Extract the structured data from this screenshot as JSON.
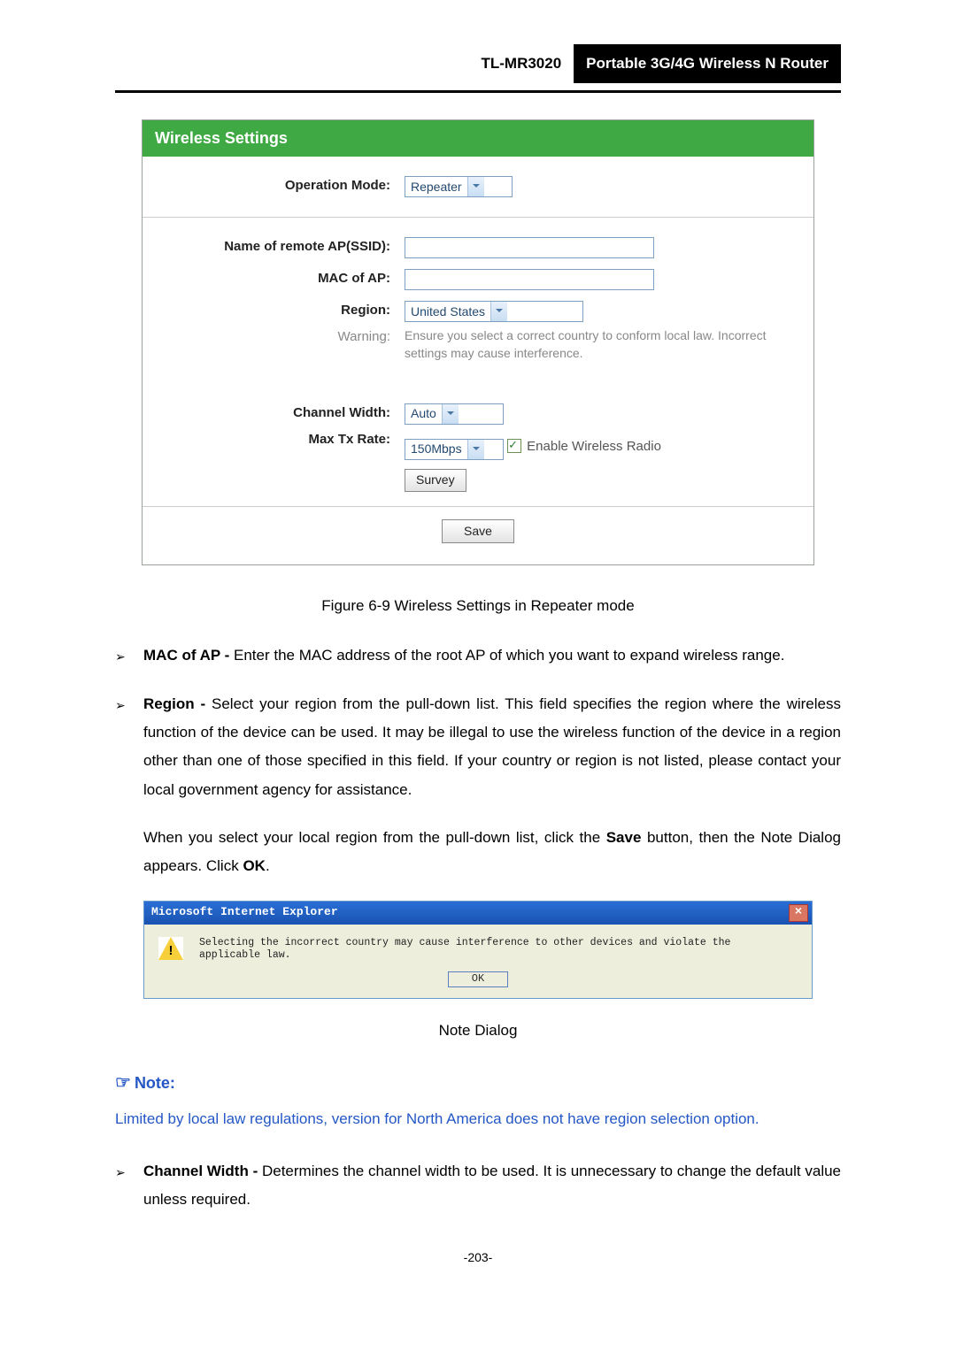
{
  "header": {
    "model": "TL-MR3020",
    "product": "Portable 3G/4G Wireless N Router"
  },
  "panel": {
    "title": "Wireless Settings",
    "labels": {
      "operation_mode": "Operation Mode:",
      "ssid": "Name of remote AP(SSID):",
      "mac": "MAC of AP:",
      "region": "Region:",
      "warning": "Warning:",
      "channel_width": "Channel Width:",
      "max_tx_rate": "Max Tx Rate:"
    },
    "values": {
      "operation_mode": "Repeater",
      "region": "United States",
      "channel_width": "Auto",
      "max_tx_rate": "150Mbps"
    },
    "warning_text": "Ensure you select a correct country to conform local law. Incorrect settings may cause interference.",
    "enable_radio": "Enable Wireless Radio",
    "survey": "Survey",
    "save": "Save"
  },
  "caption_fig": "Figure 6-9 Wireless Settings in Repeater mode",
  "bullets": {
    "mac_term": "MAC of AP -",
    "mac_text": " Enter the MAC address of the root AP of which you want to expand wireless range.",
    "region_term": "Region -",
    "region_text": " Select your region from the pull-down list. This field specifies the region where the wireless function of the device can be used. It may be illegal to use the wireless function of the device in a region other than one of those specified in this field. If your country or region is not listed, please contact your local government agency for assistance.",
    "region_follow_pre": "When you select your local region from the pull-down list, click the ",
    "save_word": "Save",
    "region_follow_mid": " button, then the Note Dialog appears. Click ",
    "ok_word": "OK",
    "region_follow_end": ".",
    "cw_term": "Channel Width -",
    "cw_text": " Determines the channel width to be used. It is unnecessary to change the default value unless required."
  },
  "ie": {
    "title": "Microsoft Internet Explorer",
    "msg": "Selecting the incorrect country may cause interference to other devices and violate the applicable law.",
    "ok": "OK"
  },
  "note_dialog_caption": "Note Dialog",
  "note_head": "Note:",
  "note_body": "Limited by local law regulations, version for North America does not have region selection option.",
  "page_number": "-203-"
}
